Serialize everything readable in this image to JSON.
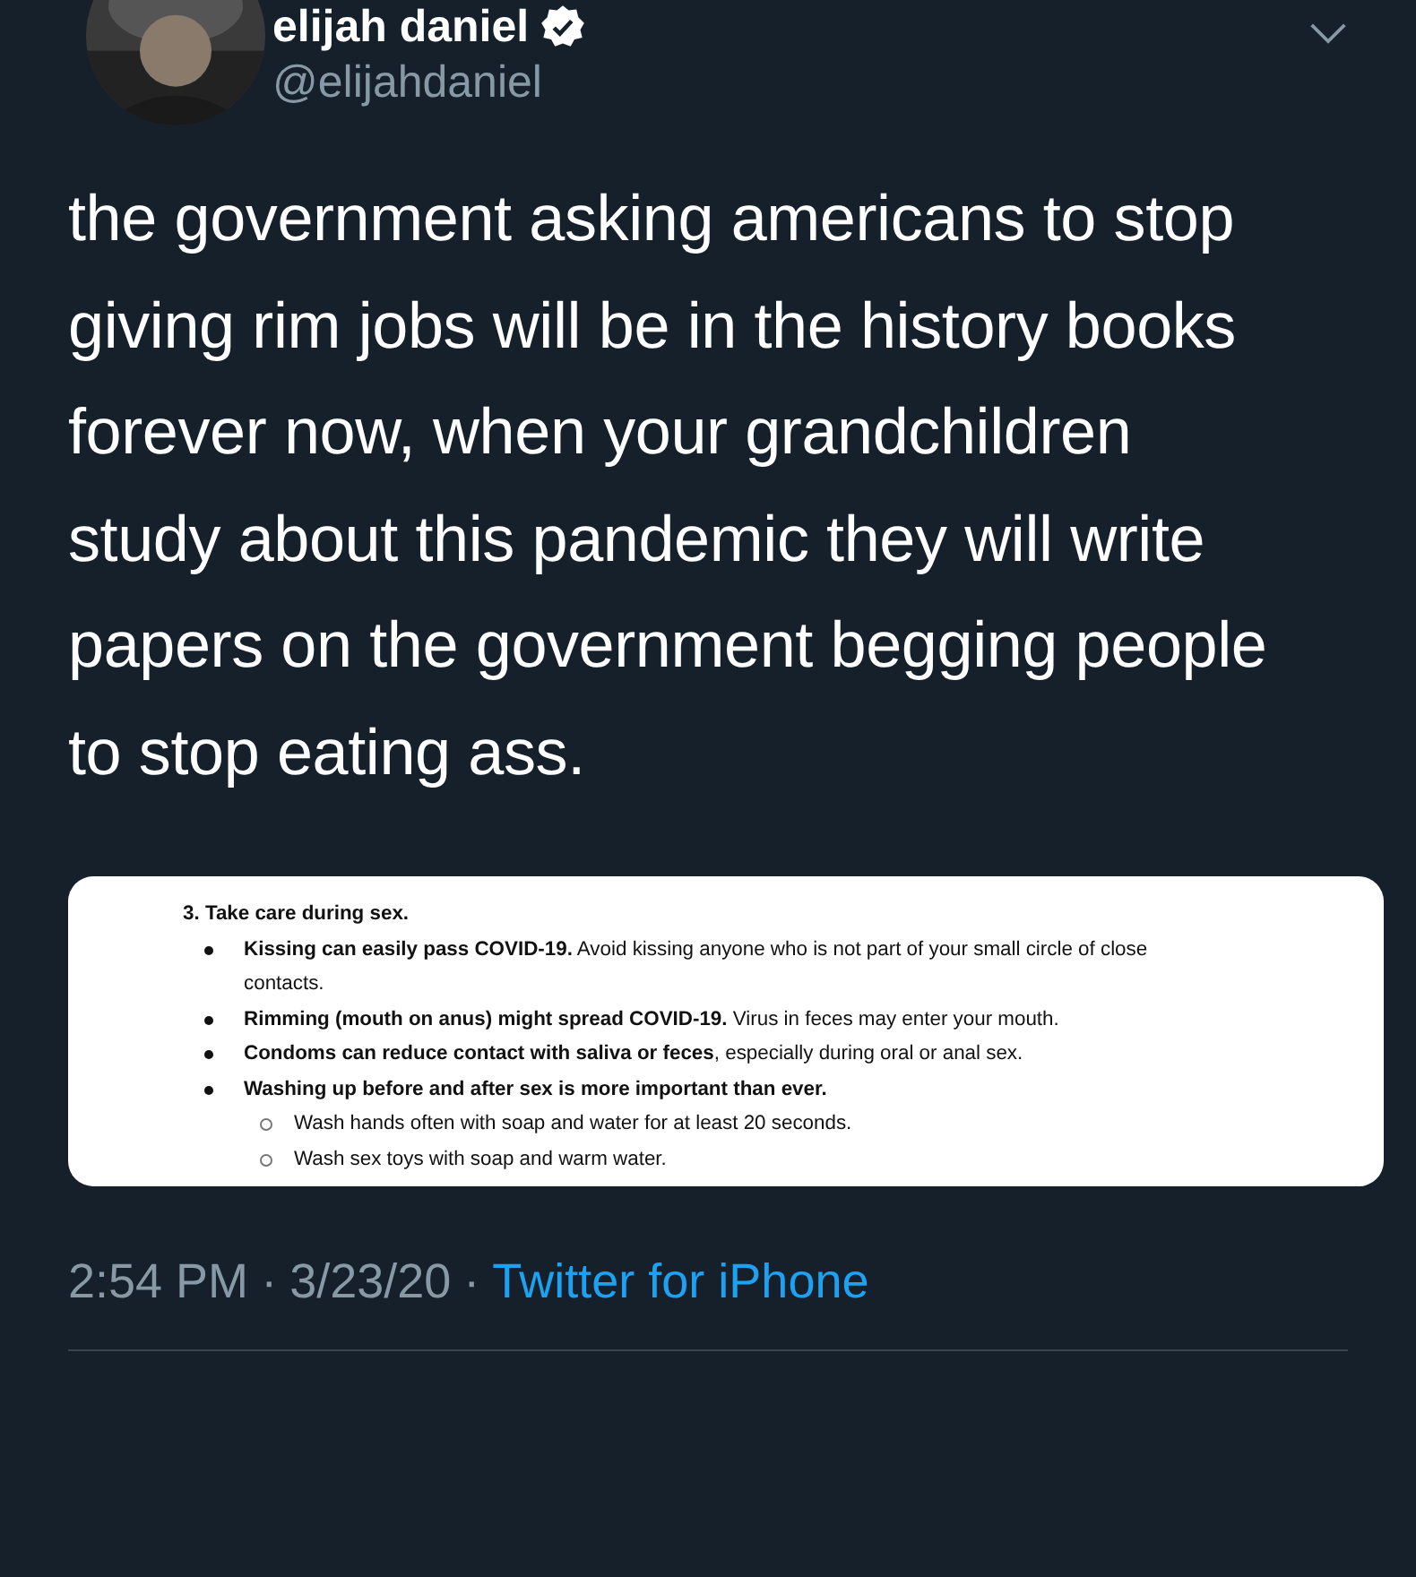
{
  "author": {
    "name": "elijah daniel",
    "verified": true,
    "handle": "@elijahdaniel"
  },
  "text": "the government asking americans to stop giving rim jobs will be in the history books forever now, when your grandchildren study about this pandemic they will write papers on the government begging people to stop eating ass.",
  "attachment": {
    "heading": "3. Take care during sex.",
    "items": [
      {
        "text": "**Kissing can easily pass COVID-19.** Avoid kissing anyone who is not part of your small circle of close contacts."
      },
      {
        "text": "**Rimming (mouth on anus) might spread COVID-19.** Virus in feces may enter your mouth."
      },
      {
        "text": "**Condoms can reduce contact with saliva or feces**, especially during oral or anal sex."
      },
      {
        "text": "**Washing up before and after sex is more important than ever.**",
        "children": [
          {
            "text": "Wash hands often with soap and water for at least 20 seconds."
          },
          {
            "text": "Wash sex toys with soap and warm water."
          }
        ]
      }
    ]
  },
  "meta": {
    "time": "2:54 PM",
    "separators": [
      "·",
      "·"
    ],
    "date": "3/23/20",
    "source": "Twitter for iPhone"
  }
}
